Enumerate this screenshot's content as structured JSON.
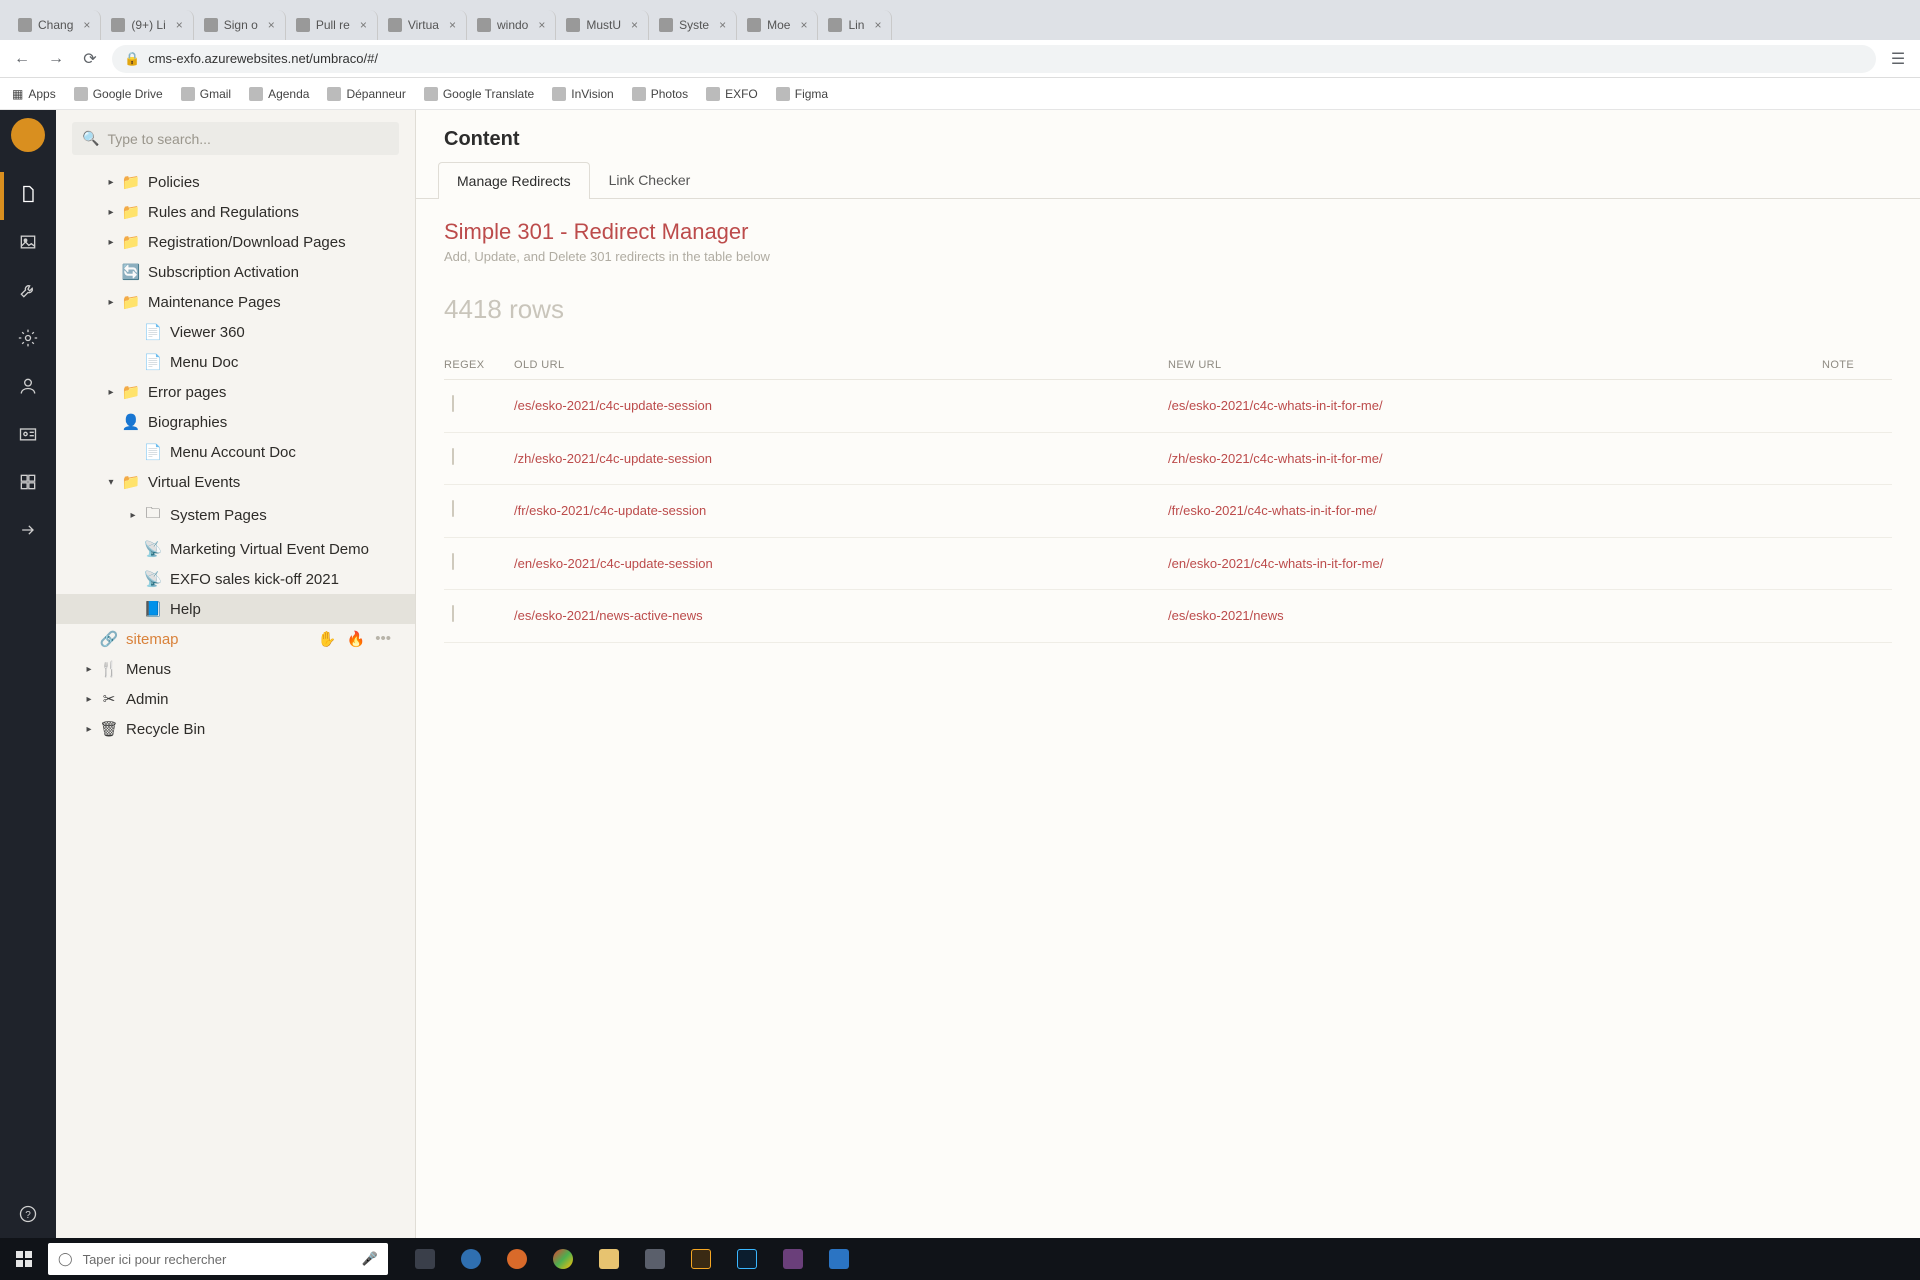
{
  "browser": {
    "tabs": [
      {
        "label": "Chang",
        "active": false
      },
      {
        "label": "(9+) Li",
        "active": false
      },
      {
        "label": "Sign o",
        "active": false
      },
      {
        "label": "Pull re",
        "active": false
      },
      {
        "label": "Virtua",
        "active": false
      },
      {
        "label": "windo",
        "active": false
      },
      {
        "label": "MustU",
        "active": false
      },
      {
        "label": "Syste",
        "active": false
      },
      {
        "label": "Moe",
        "active": false
      },
      {
        "label": "Lin",
        "active": false
      }
    ],
    "url": "cms-exfo.azurewebsites.net/umbraco/#/",
    "bookmarks": [
      {
        "label": "Apps"
      },
      {
        "label": "Google Drive"
      },
      {
        "label": "Gmail"
      },
      {
        "label": "Agenda"
      },
      {
        "label": "Dépanneur"
      },
      {
        "label": "Google Translate"
      },
      {
        "label": "InVision"
      },
      {
        "label": "Photos"
      },
      {
        "label": "EXFO"
      },
      {
        "label": "Figma"
      }
    ]
  },
  "cms": {
    "search_placeholder": "Type to search...",
    "rail": [
      {
        "name": "content",
        "icon": "file",
        "active": true
      },
      {
        "name": "media",
        "icon": "image",
        "active": false
      },
      {
        "name": "settings",
        "icon": "wrench",
        "active": false
      },
      {
        "name": "developer",
        "icon": "gear",
        "active": false
      },
      {
        "name": "users",
        "icon": "user",
        "active": false
      },
      {
        "name": "members",
        "icon": "idcard",
        "active": false
      },
      {
        "name": "forms",
        "icon": "grid",
        "active": false
      },
      {
        "name": "translate",
        "icon": "arrow",
        "active": false
      }
    ],
    "tree": [
      {
        "depth": 2,
        "arrow": "right",
        "icon": "folder",
        "label": "Policies"
      },
      {
        "depth": 2,
        "arrow": "right",
        "icon": "folder",
        "label": "Rules and Regulations"
      },
      {
        "depth": 2,
        "arrow": "right",
        "icon": "folder",
        "label": "Registration/Download Pages"
      },
      {
        "depth": 2,
        "arrow": "",
        "icon": "refresh",
        "label": "Subscription Activation"
      },
      {
        "depth": 2,
        "arrow": "right",
        "icon": "folder",
        "label": "Maintenance Pages"
      },
      {
        "depth": 3,
        "arrow": "",
        "icon": "file",
        "label": "Viewer 360"
      },
      {
        "depth": 3,
        "arrow": "",
        "icon": "file",
        "label": "Menu Doc"
      },
      {
        "depth": 2,
        "arrow": "right",
        "icon": "folder",
        "label": "Error pages"
      },
      {
        "depth": 2,
        "arrow": "",
        "icon": "person",
        "label": "Biographies"
      },
      {
        "depth": 3,
        "arrow": "",
        "icon": "file",
        "label": "Menu Account Doc"
      },
      {
        "depth": 2,
        "arrow": "down",
        "icon": "folder",
        "label": "Virtual Events"
      },
      {
        "depth": 3,
        "arrow": "right",
        "icon": "folder-o",
        "label": "System Pages"
      },
      {
        "depth": 3,
        "arrow": "",
        "icon": "antenna",
        "label": "Marketing Virtual Event Demo"
      },
      {
        "depth": 3,
        "arrow": "",
        "icon": "antenna",
        "label": "EXFO sales kick-off 2021"
      },
      {
        "depth": 3,
        "arrow": "",
        "icon": "help",
        "label": "Help",
        "selected": true
      },
      {
        "depth": 1,
        "arrow": "",
        "icon": "sitemap",
        "label": "sitemap",
        "special": true,
        "actions": true
      },
      {
        "depth": 1,
        "arrow": "right",
        "icon": "menu",
        "label": "Menus"
      },
      {
        "depth": 1,
        "arrow": "right",
        "icon": "tools",
        "label": "Admin"
      },
      {
        "depth": 1,
        "arrow": "right",
        "icon": "trash",
        "label": "Recycle Bin"
      }
    ],
    "content_header": "Content",
    "tabs": [
      {
        "label": "Manage Redirects",
        "active": true
      },
      {
        "label": "Link Checker",
        "active": false
      }
    ],
    "panel": {
      "title": "Simple 301 - Redirect Manager",
      "subtitle": "Add, Update, and Delete 301 redirects in the table below",
      "rows_label": "4418 rows",
      "cols": {
        "regex": "REGEX",
        "old": "OLD URL",
        "new": "NEW URL",
        "note": "NOTE"
      },
      "rows": [
        {
          "old": "/es/esko-2021/c4c-update-session",
          "new": "/es/esko-2021/c4c-whats-in-it-for-me/"
        },
        {
          "old": "/zh/esko-2021/c4c-update-session",
          "new": "/zh/esko-2021/c4c-whats-in-it-for-me/"
        },
        {
          "old": "/fr/esko-2021/c4c-update-session",
          "new": "/fr/esko-2021/c4c-whats-in-it-for-me/"
        },
        {
          "old": "/en/esko-2021/c4c-update-session",
          "new": "/en/esko-2021/c4c-whats-in-it-for-me/"
        },
        {
          "old": "/es/esko-2021/news-active-news",
          "new": "/es/esko-2021/news"
        }
      ]
    }
  },
  "taskbar": {
    "search_placeholder": "Taper ici pour rechercher"
  }
}
